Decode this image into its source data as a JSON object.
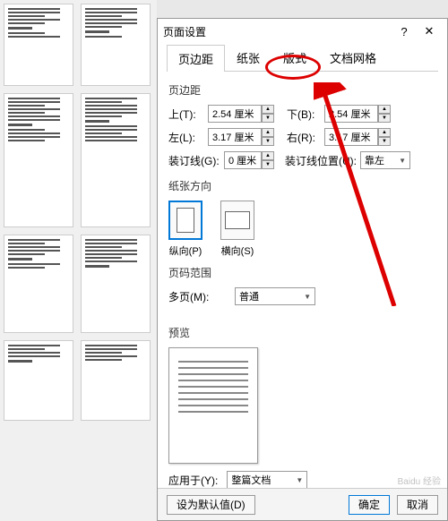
{
  "dialog": {
    "title": "页面设置",
    "help": "?",
    "close": "✕"
  },
  "tabs": {
    "margin": "页边距",
    "paper": "纸张",
    "layout": "版式",
    "grid": "文档网格"
  },
  "margins": {
    "section": "页边距",
    "top_label": "上(T):",
    "top_value": "2.54 厘米",
    "bottom_label": "下(B):",
    "bottom_value": "2.54 厘米",
    "left_label": "左(L):",
    "left_value": "3.17 厘米",
    "right_label": "右(R):",
    "right_value": "3.17 厘米",
    "gutter_label": "装订线(G):",
    "gutter_value": "0 厘米",
    "gutter_pos_label": "装订线位置(U):",
    "gutter_pos_value": "靠左"
  },
  "orientation": {
    "section": "纸张方向",
    "portrait": "纵向(P)",
    "landscape": "横向(S)"
  },
  "pages": {
    "section": "页码范围",
    "multi_label": "多页(M):",
    "multi_value": "普通"
  },
  "preview": {
    "section": "预览"
  },
  "apply": {
    "label": "应用于(Y):",
    "value": "整篇文档"
  },
  "buttons": {
    "default": "设为默认值(D)",
    "ok": "确定",
    "cancel": "取消"
  },
  "watermark": "Baidu 经验"
}
